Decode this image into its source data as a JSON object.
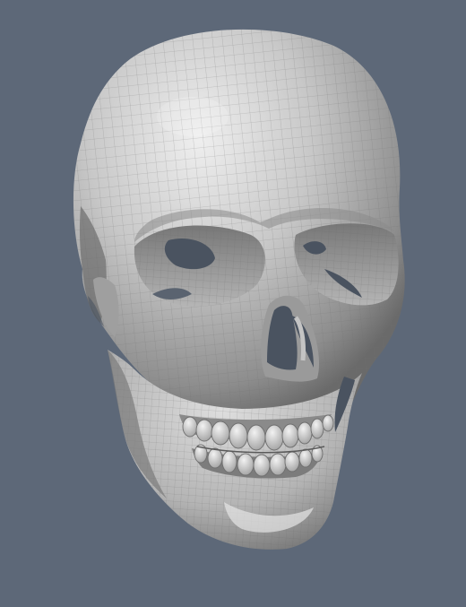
{
  "scene": {
    "subject": "skull-mesh",
    "background_color": "#5d6878",
    "mesh_base_color": "#c9c9c9",
    "mesh_shadow_color": "#6e6e6e",
    "mesh_highlight_color": "#f0f0f0",
    "wireframe_color": "#707070",
    "cavity_color": "#4a5360",
    "icons": [
      "skull-model-icon"
    ]
  }
}
